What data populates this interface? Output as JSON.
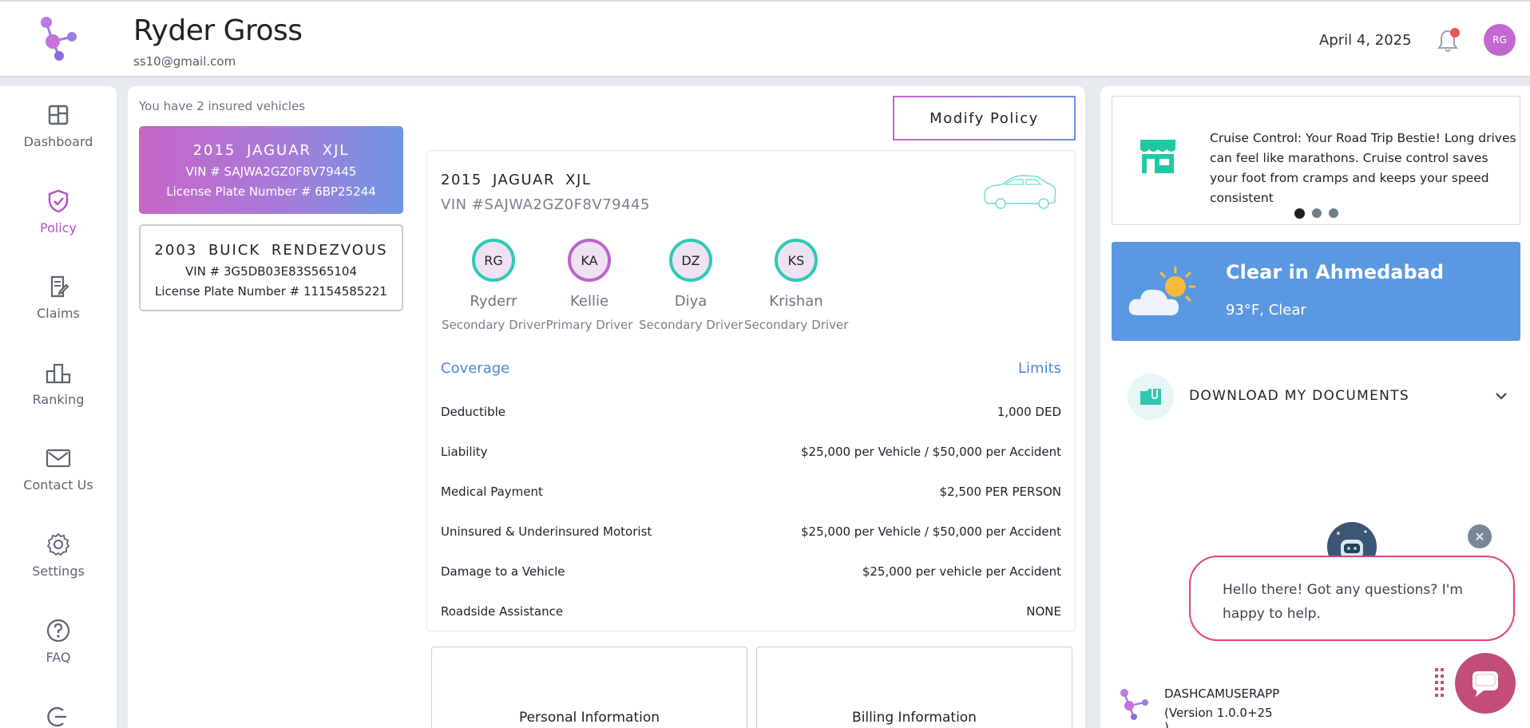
{
  "header": {
    "user_name": "Ryder Gross",
    "user_email": "ss10@gmail.com",
    "date": "April 4, 2025",
    "avatar_initials": "RG"
  },
  "sidebar": {
    "items": [
      {
        "label": "Dashboard",
        "icon": "dashboard-icon"
      },
      {
        "label": "Policy",
        "icon": "shield-check-icon",
        "active": true
      },
      {
        "label": "Claims",
        "icon": "document-edit-icon"
      },
      {
        "label": "Ranking",
        "icon": "podium-icon"
      },
      {
        "label": "Contact Us",
        "icon": "envelope-icon"
      },
      {
        "label": "Settings",
        "icon": "gear-icon"
      },
      {
        "label": "FAQ",
        "icon": "question-icon"
      },
      {
        "label": "",
        "icon": "logout-icon"
      }
    ]
  },
  "vehicles": {
    "count_text": "You have 2 insured vehicles",
    "list": [
      {
        "title": "2015 JAGUAR XJL",
        "vin": "VIN # SAJWA2GZ0F8V79445",
        "plate": "License Plate Number # 6BP25244"
      },
      {
        "title": "2003 BUICK RENDEZVOUS",
        "vin": "VIN # 3G5DB03E83S565104",
        "plate": "License Plate Number # 11154585221"
      }
    ]
  },
  "policy": {
    "modify_label": "Modify Policy",
    "vehicle_title": "2015 JAGUAR XJL",
    "vehicle_vin": "VIN #SAJWA2GZ0F8V79445",
    "drivers": [
      {
        "initials": "RG",
        "name": "Ryderr",
        "role": "Secondary Driver"
      },
      {
        "initials": "KA",
        "name": "Kellie",
        "role": "Primary Driver"
      },
      {
        "initials": "DZ",
        "name": "Diya",
        "role": "Secondary Driver"
      },
      {
        "initials": "KS",
        "name": "Krishan",
        "role": "Secondary Driver"
      }
    ],
    "coverage_header": "Coverage",
    "limits_header": "Limits",
    "coverage": [
      {
        "name": "Deductible",
        "limit": "1,000 DED"
      },
      {
        "name": "Liability",
        "limit": "$25,000 per Vehicle / $50,000 per Accident"
      },
      {
        "name": "Medical Payment",
        "limit": "$2,500 PER PERSON"
      },
      {
        "name": "Uninsured & Underinsured Motorist",
        "limit": "$25,000 per Vehicle / $50,000 per Accident"
      },
      {
        "name": "Damage to a Vehicle",
        "limit": "$25,000 per vehicle per Accident"
      },
      {
        "name": "Roadside Assistance",
        "limit": "NONE"
      }
    ],
    "personal_info_label": "Personal Information",
    "billing_info_label": "Billing Information"
  },
  "tip": {
    "text": "Cruise Control: Your Road Trip Bestie! Long drives can feel like marathons. Cruise control saves your foot from cramps and keeps your speed consistent"
  },
  "weather": {
    "title": "Clear in Ahmedabad",
    "subtitle": "93°F, Clear"
  },
  "documents": {
    "label": "DOWNLOAD MY DOCUMENTS"
  },
  "chat": {
    "message": "Hello there! Got any questions? I'm happy to help.",
    "close_symbol": "✕"
  },
  "app": {
    "name": "DASHCAMUSERAPP",
    "version": "(Version 1.0.0+25 )"
  },
  "colors": {
    "accent_purple": "#b44fc7",
    "accent_blue": "#4f86d6",
    "weather_bg": "#5b98e2",
    "teal": "#30c9b7",
    "chat_pink": "#c24d79"
  }
}
